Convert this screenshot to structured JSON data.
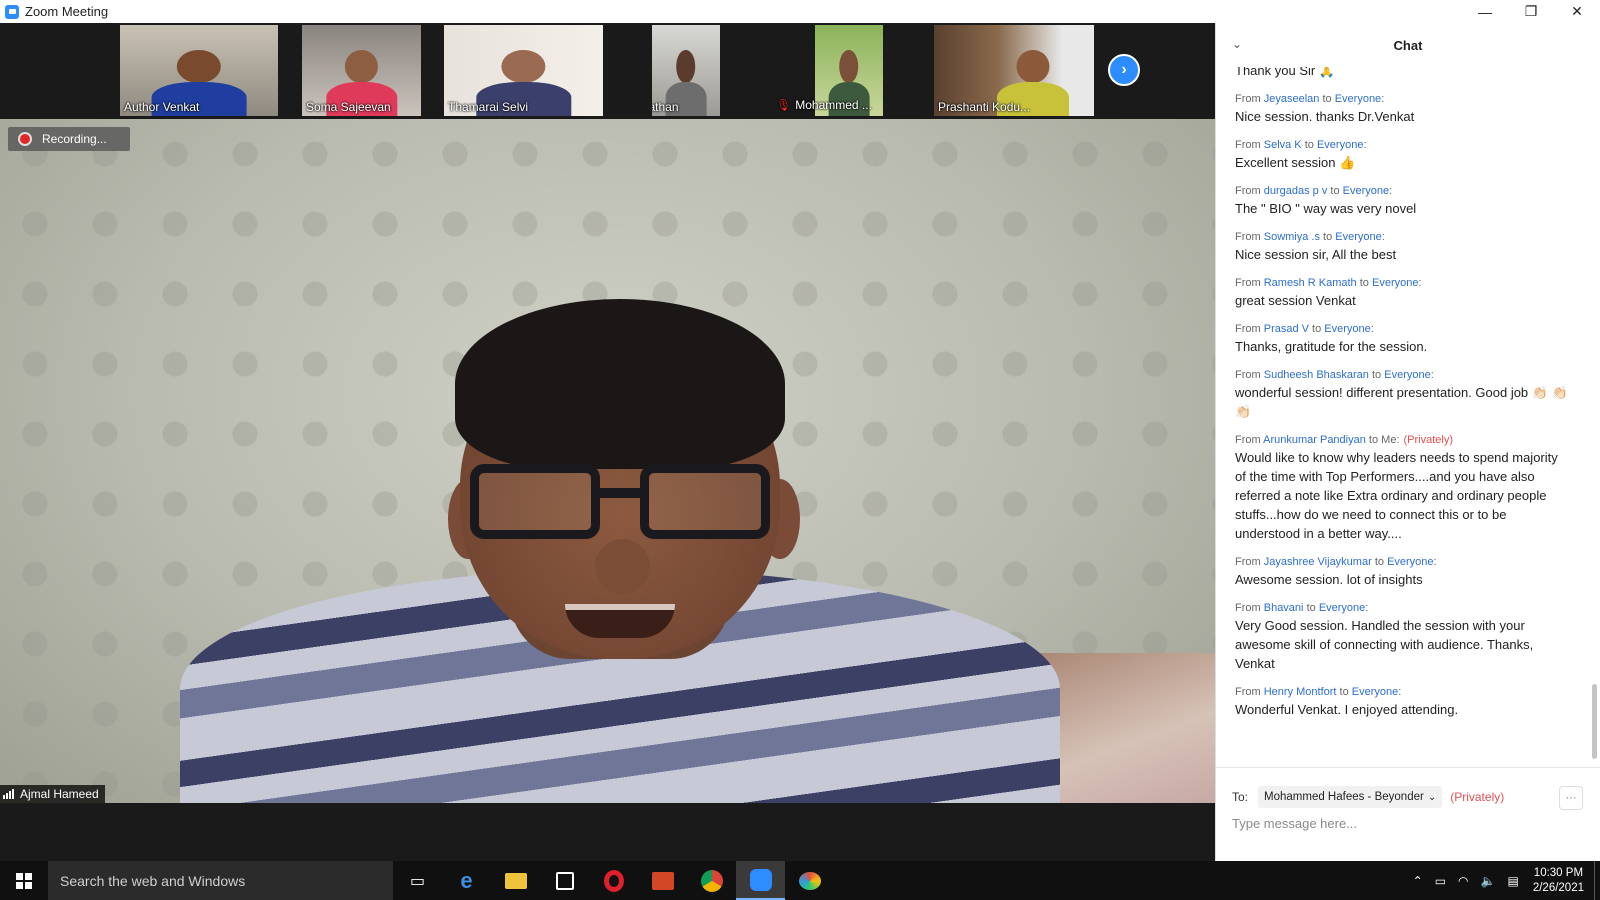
{
  "window": {
    "title": "Zoom Meeting",
    "controls": {
      "minimize": "—",
      "restore": "❐",
      "close": "✕"
    }
  },
  "thumbnails": [
    {
      "name": "Author Venkat",
      "muted": false
    },
    {
      "name": "Soma Sajeevan",
      "muted": false
    },
    {
      "name": "Thamarai Selvi",
      "muted": false
    },
    {
      "name": "Viswanathan",
      "muted": false
    },
    {
      "name": "Mohammed ...",
      "muted": true
    },
    {
      "name": "Prashanti Kodu...",
      "muted": false
    }
  ],
  "next_icon": "chevron-right-icon",
  "recording": {
    "label": "Recording..."
  },
  "active_speaker": {
    "name": "Ajmal Hameed"
  },
  "chat": {
    "title": "Chat",
    "partial_top": "Thank you Sir 🙏",
    "messages": [
      {
        "from": "Jeyaseelan",
        "to": "Everyone",
        "private": false,
        "text": "Nice session. thanks Dr.Venkat"
      },
      {
        "from": "Selva K",
        "to": "Everyone",
        "private": false,
        "text": "Excellent session 👍"
      },
      {
        "from": "durgadas p v",
        "to": "Everyone",
        "private": false,
        "text": "The \" BIO \" way was very novel"
      },
      {
        "from": "Sowmiya .s",
        "to": "Everyone",
        "private": false,
        "text": "Nice session sir,  All the best"
      },
      {
        "from": "Ramesh R Kamath",
        "to": "Everyone",
        "private": false,
        "text": "great session Venkat"
      },
      {
        "from": "Prasad V",
        "to": "Everyone",
        "private": false,
        "text": "Thanks, gratitude for the session."
      },
      {
        "from": "Sudheesh Bhaskaran",
        "to": "Everyone",
        "private": false,
        "text": "wonderful session! different presentation. Good job 👏🏻 👏🏻👏🏻"
      },
      {
        "from": "Arunkumar Pandiyan",
        "to": "Me",
        "private": true,
        "private_label": "(Privately)",
        "text": "Would like to know why leaders needs to spend majority of the time with Top Performers....and you have also referred a note like Extra ordinary and ordinary people stuffs...how do we need to connect this or to be understood in a better way...."
      },
      {
        "from": "Jayashree Vijaykumar",
        "to": "Everyone",
        "private": false,
        "text": "Awesome session.  lot of insights"
      },
      {
        "from": "Bhavani",
        "to": "Everyone",
        "private": false,
        "text": "Very Good session. Handled the session with your awesome skill of connecting with audience. Thanks, Venkat"
      },
      {
        "from": "Henry Montfort",
        "to": "Everyone",
        "private": false,
        "text": "Wonderful Venkat. I enjoyed attending."
      }
    ],
    "labels": {
      "from": "From",
      "to": "to"
    },
    "footer": {
      "to_label": "To:",
      "recipient": "Mohammed Hafees - Beyonder",
      "privately": "(Privately)",
      "more": "···",
      "placeholder": "Type message here..."
    }
  },
  "taskbar": {
    "search_placeholder": "Search the web and Windows",
    "apps": [
      "task-view-icon",
      "edge-icon",
      "file-explorer-icon",
      "store-icon",
      "opera-icon",
      "powerpoint-icon",
      "chrome-icon",
      "zoom-icon",
      "paint-icon"
    ],
    "time": "10:30 PM",
    "date": "2/26/2021"
  },
  "colors": {
    "accent": "#2d8cff",
    "link": "#2d6ecf",
    "private": "#e05050"
  }
}
